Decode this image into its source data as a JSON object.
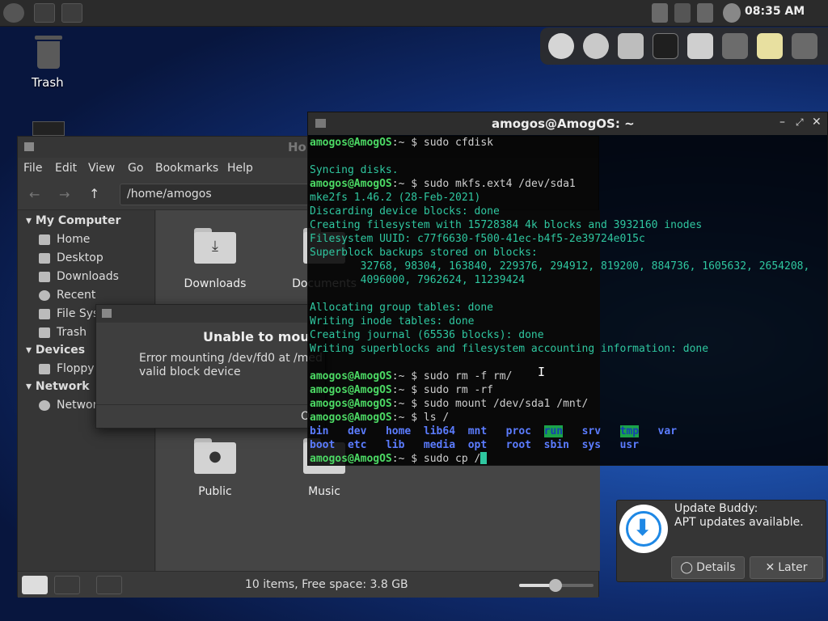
{
  "top_panel": {
    "clock": "08:35 AM"
  },
  "desktop": {
    "trash_label": "Trash"
  },
  "file_manager": {
    "title": "Ho",
    "menu": [
      "File",
      "Edit",
      "View",
      "Go",
      "Bookmarks",
      "Help"
    ],
    "path": "/home/amogos",
    "sidebar": {
      "my_computer": "My Computer",
      "items": [
        "Home",
        "Desktop",
        "Downloads",
        "Recent",
        "File Sys",
        "Trash"
      ],
      "devices": "Devices",
      "device_items": [
        "Floppy"
      ],
      "network": "Network",
      "network_items": [
        "Networ"
      ]
    },
    "folders": {
      "downloads": "Downloads",
      "documents": "Documents",
      "public": "Public",
      "music": "Music"
    },
    "status": "10 items, Free space: 3.8 GB"
  },
  "dialog": {
    "title": "Unable to mou",
    "message": "Error mounting /dev/fd0 at /med\nvalid block device",
    "ok": "O"
  },
  "terminal": {
    "title": "amogos@AmogOS: ~",
    "user": "amogos@AmogOS",
    "sep": ":~ $ ",
    "lines": [
      {
        "type": "cmd",
        "text": "sudo cfdisk"
      },
      {
        "type": "out",
        "text": ""
      },
      {
        "type": "out",
        "text": "Syncing disks."
      },
      {
        "type": "cmd",
        "text": "sudo mkfs.ext4 /dev/sda1"
      },
      {
        "type": "out",
        "text": "mke2fs 1.46.2 (28-Feb-2021)"
      },
      {
        "type": "out",
        "text": "Discarding device blocks: done"
      },
      {
        "type": "out",
        "text": "Creating filesystem with 15728384 4k blocks and 3932160 inodes"
      },
      {
        "type": "out",
        "text": "Filesystem UUID: c77f6630-f500-41ec-b4f5-2e39724e015c"
      },
      {
        "type": "out",
        "text": "Superblock backups stored on blocks:"
      },
      {
        "type": "out",
        "text": "        32768, 98304, 163840, 229376, 294912, 819200, 884736, 1605632, 2654208,"
      },
      {
        "type": "out",
        "text": "        4096000, 7962624, 11239424"
      },
      {
        "type": "out",
        "text": ""
      },
      {
        "type": "out",
        "text": "Allocating group tables: done"
      },
      {
        "type": "out",
        "text": "Writing inode tables: done"
      },
      {
        "type": "out",
        "text": "Creating journal (65536 blocks): done"
      },
      {
        "type": "out",
        "text": "Writing superblocks and filesystem accounting information: done"
      },
      {
        "type": "out",
        "text": ""
      },
      {
        "type": "cmd",
        "text": "sudo rm -f rm/"
      },
      {
        "type": "cmd",
        "text": "sudo rm -rf"
      },
      {
        "type": "cmd",
        "text": "sudo mount /dev/sda1 /mnt/"
      },
      {
        "type": "cmd",
        "text": "ls /"
      }
    ],
    "ls_row1": [
      "bin",
      "dev",
      "home",
      "lib64",
      "mnt",
      "proc",
      "run",
      "srv",
      "tmp",
      "var"
    ],
    "ls_row2": [
      "boot",
      "etc",
      "lib",
      "media",
      "opt",
      "root",
      "sbin",
      "sys",
      "usr"
    ],
    "last_cmd": "sudo cp /"
  },
  "notification": {
    "title": "Update Buddy:",
    "message": "APT updates available.",
    "details": "Details",
    "later": "Later"
  },
  "colors": {
    "accent_green": "#1aa34a",
    "term_text": "#2fc7a0",
    "prompt_green": "#4cd964",
    "ls_blue": "#5b7cff"
  }
}
